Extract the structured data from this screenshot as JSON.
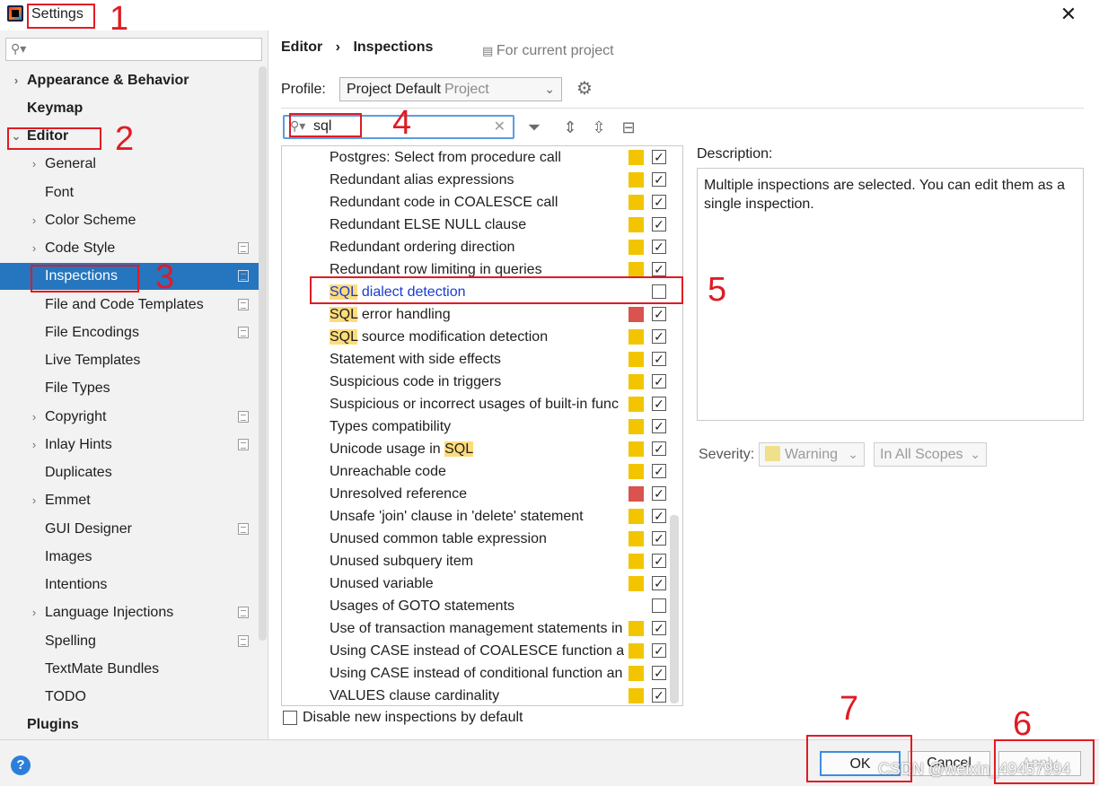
{
  "window": {
    "title": "Settings",
    "close_glyph": "✕"
  },
  "sidebar": {
    "search_placeholder": "",
    "items": [
      {
        "label": "Appearance & Behavior",
        "arrow": "›"
      },
      {
        "label": "Keymap",
        "arrow": ""
      },
      {
        "label": "Editor",
        "arrow": "⌄"
      },
      {
        "label": "General",
        "arrow": "›"
      },
      {
        "label": "Font",
        "arrow": ""
      },
      {
        "label": "Color Scheme",
        "arrow": "›"
      },
      {
        "label": "Code Style",
        "arrow": "›"
      },
      {
        "label": "Inspections",
        "arrow": ""
      },
      {
        "label": "File and Code Templates",
        "arrow": ""
      },
      {
        "label": "File Encodings",
        "arrow": ""
      },
      {
        "label": "Live Templates",
        "arrow": ""
      },
      {
        "label": "File Types",
        "arrow": ""
      },
      {
        "label": "Copyright",
        "arrow": "›"
      },
      {
        "label": "Inlay Hints",
        "arrow": "›"
      },
      {
        "label": "Duplicates",
        "arrow": ""
      },
      {
        "label": "Emmet",
        "arrow": "›"
      },
      {
        "label": "GUI Designer",
        "arrow": ""
      },
      {
        "label": "Images",
        "arrow": ""
      },
      {
        "label": "Intentions",
        "arrow": ""
      },
      {
        "label": "Language Injections",
        "arrow": "›"
      },
      {
        "label": "Spelling",
        "arrow": ""
      },
      {
        "label": "TextMate Bundles",
        "arrow": ""
      },
      {
        "label": "TODO",
        "arrow": ""
      },
      {
        "label": "Plugins",
        "arrow": ""
      }
    ],
    "selected": "Inspections"
  },
  "breadcrumb": {
    "parent": "Editor",
    "separator": "›",
    "current": "Inspections"
  },
  "for_current_project": "For current project",
  "profile": {
    "label": "Profile:",
    "value": "Project Default",
    "scope": "Project"
  },
  "search": {
    "value": "sql"
  },
  "inspections": [
    {
      "pre": "",
      "hl": "",
      "post": "Postgres: Select from procedure call",
      "severity": "warning",
      "checked": true
    },
    {
      "pre": "",
      "hl": "",
      "post": "Redundant alias expressions",
      "severity": "warning",
      "checked": true
    },
    {
      "pre": "",
      "hl": "",
      "post": "Redundant code in COALESCE call",
      "severity": "warning",
      "checked": true
    },
    {
      "pre": "",
      "hl": "",
      "post": "Redundant ELSE NULL clause",
      "severity": "warning",
      "checked": true
    },
    {
      "pre": "",
      "hl": "",
      "post": "Redundant ordering direction",
      "severity": "warning",
      "checked": true
    },
    {
      "pre": "",
      "hl": "",
      "post": "Redundant row limiting in queries",
      "severity": "warning",
      "checked": true
    },
    {
      "pre": "",
      "hl": "SQL",
      "post": " dialect detection",
      "severity": "none",
      "checked": false,
      "blue": true
    },
    {
      "pre": "",
      "hl": "SQL",
      "post": " error handling",
      "severity": "error",
      "checked": true
    },
    {
      "pre": "",
      "hl": "SQL",
      "post": " source modification detection",
      "severity": "warning",
      "checked": true
    },
    {
      "pre": "",
      "hl": "",
      "post": "Statement with side effects",
      "severity": "warning",
      "checked": true
    },
    {
      "pre": "",
      "hl": "",
      "post": "Suspicious code in triggers",
      "severity": "warning",
      "checked": true
    },
    {
      "pre": "",
      "hl": "",
      "post": "Suspicious or incorrect usages of built-in func",
      "severity": "warning",
      "checked": true
    },
    {
      "pre": "",
      "hl": "",
      "post": "Types compatibility",
      "severity": "warning",
      "checked": true
    },
    {
      "pre": "Unicode usage in ",
      "hl": "SQL",
      "post": "",
      "severity": "warning",
      "checked": true
    },
    {
      "pre": "",
      "hl": "",
      "post": "Unreachable code",
      "severity": "warning",
      "checked": true
    },
    {
      "pre": "",
      "hl": "",
      "post": "Unresolved reference",
      "severity": "error",
      "checked": true
    },
    {
      "pre": "",
      "hl": "",
      "post": "Unsafe 'join' clause in 'delete' statement",
      "severity": "warning",
      "checked": true
    },
    {
      "pre": "",
      "hl": "",
      "post": "Unused common table expression",
      "severity": "warning",
      "checked": true
    },
    {
      "pre": "",
      "hl": "",
      "post": "Unused subquery item",
      "severity": "warning",
      "checked": true
    },
    {
      "pre": "",
      "hl": "",
      "post": "Unused variable",
      "severity": "warning",
      "checked": true
    },
    {
      "pre": "",
      "hl": "",
      "post": "Usages of GOTO statements",
      "severity": "none",
      "checked": false
    },
    {
      "pre": "",
      "hl": "",
      "post": "Use of transaction management statements in",
      "severity": "warning",
      "checked": true
    },
    {
      "pre": "",
      "hl": "",
      "post": "Using CASE instead of COALESCE function and",
      "severity": "warning",
      "checked": true
    },
    {
      "pre": "",
      "hl": "",
      "post": "Using CASE instead of conditional function an",
      "severity": "warning",
      "checked": true
    },
    {
      "pre": "",
      "hl": "",
      "post": "VALUES clause cardinality",
      "severity": "warning",
      "checked": true
    }
  ],
  "severity_colors": {
    "warning": "#f2c500",
    "error": "#d9534f"
  },
  "disable_new": {
    "label": "Disable new inspections by default",
    "checked": false
  },
  "description": {
    "label": "Description:",
    "text": "Multiple inspections are selected. You can edit them as a single inspection."
  },
  "severity_row": {
    "label": "Severity:",
    "value": "Warning",
    "scope": "In All Scopes"
  },
  "buttons": {
    "ok": "OK",
    "cancel": "Cancel",
    "apply": "Apply"
  },
  "annotations": [
    "1",
    "2",
    "3",
    "4",
    "5",
    "6",
    "7"
  ],
  "watermark": "CSDN @weixin_49457994"
}
